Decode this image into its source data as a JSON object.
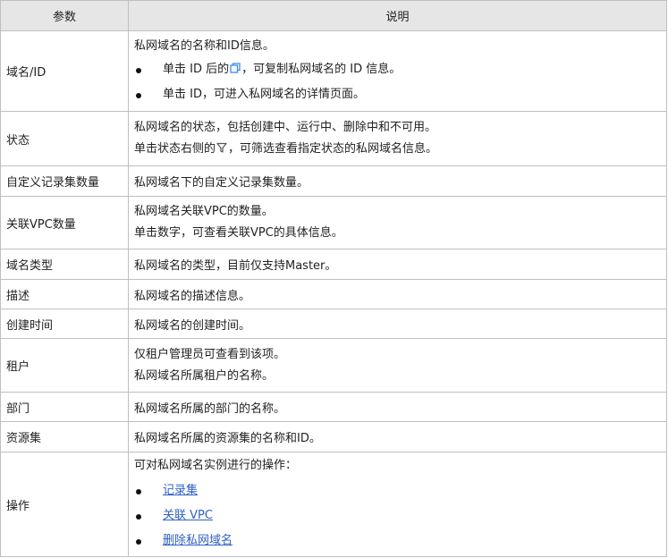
{
  "header": {
    "param": "参数",
    "desc": "说明"
  },
  "rows": {
    "domain_id": {
      "name": "域名/ID",
      "intro": "私网域名的名称和ID信息。",
      "bullet1_pre": "单击 ID 后的",
      "bullet1_post": "，可复制私网域名的 ID 信息。",
      "bullet2": "单击 ID，可进入私网域名的详情页面。",
      "copy_icon_color": "#3b8be8"
    },
    "status": {
      "name": "状态",
      "line1": "私网域名的状态，包括创建中、运行中、删除中和不可用。",
      "line2_pre": "单击状态右侧的",
      "line2_post": "，可筛选查看指定状态的私网域名信息。"
    },
    "record_count": {
      "name": "自定义记录集数量",
      "desc": "私网域名下的自定义记录集数量。"
    },
    "vpc_count": {
      "name": "关联VPC数量",
      "line1": "私网域名关联VPC的数量。",
      "line2": "单击数字，可查看关联VPC的具体信息。"
    },
    "type": {
      "name": "域名类型",
      "desc": "私网域名的类型，目前仅支持Master。"
    },
    "description": {
      "name": "描述",
      "desc": "私网域名的描述信息。"
    },
    "created": {
      "name": "创建时间",
      "desc": "私网域名的创建时间。"
    },
    "tenant": {
      "name": "租户",
      "line1": "仅租户管理员可查看到该项。",
      "line2": "私网域名所属租户的名称。"
    },
    "department": {
      "name": "部门",
      "desc": "私网域名所属的部门的名称。"
    },
    "resource_set": {
      "name": "资源集",
      "desc": "私网域名所属的资源集的名称和ID。"
    },
    "actions": {
      "name": "操作",
      "intro": "可对私网域名实例进行的操作：",
      "links": [
        "记录集",
        "关联 VPC",
        "删除私网域名"
      ],
      "link_color": "#2f60c4"
    }
  }
}
